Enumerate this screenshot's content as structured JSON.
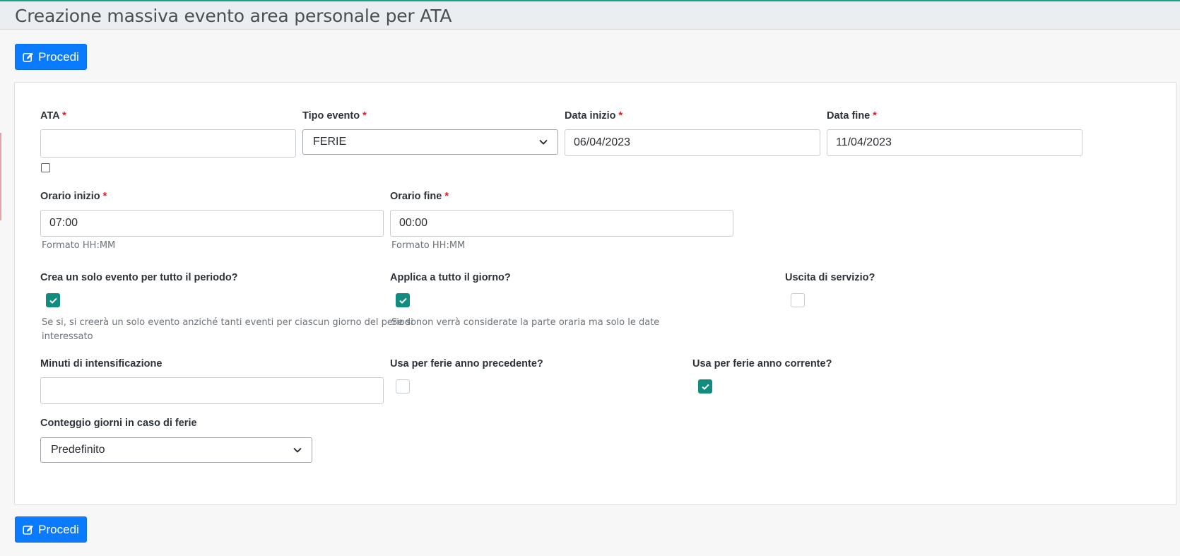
{
  "header": {
    "title": "Creazione massiva evento area personale per ATA"
  },
  "actions": {
    "proceed_label": "Procedi"
  },
  "form": {
    "required_mark": "*",
    "ata": {
      "label": "ATA",
      "value": "",
      "checkbox_checked": false
    },
    "tipo_evento": {
      "label": "Tipo evento",
      "selected": "FERIE"
    },
    "data_inizio": {
      "label": "Data inizio",
      "value": "06/04/2023"
    },
    "data_fine": {
      "label": "Data fine",
      "value": "11/04/2023"
    },
    "orario_inizio": {
      "label": "Orario inizio",
      "value": "07:00",
      "help": "Formato HH:MM"
    },
    "orario_fine": {
      "label": "Orario fine",
      "value": "00:00",
      "help": "Formato HH:MM"
    },
    "solo_evento": {
      "label": "Crea un solo evento per tutto il periodo?",
      "checked": true,
      "help_line1": "Se si, si creerà un solo evento anziché tanti eventi per ciascun giorno del periodo",
      "help_line2": "interessato"
    },
    "tutto_giorno": {
      "label": "Applica a tutto il giorno?",
      "checked": true,
      "help": "Se si non verrà considerate la parte oraria ma solo le date"
    },
    "uscita_servizio": {
      "label": "Uscita di servizio?",
      "checked": false
    },
    "minuti_intensificazione": {
      "label": "Minuti di intensificazione",
      "value": ""
    },
    "ferie_anno_precedente": {
      "label": "Usa per ferie anno precedente?",
      "checked": false
    },
    "ferie_anno_corrente": {
      "label": "Usa per ferie anno corrente?",
      "checked": true
    },
    "conteggio_giorni": {
      "label": "Conteggio giorni in caso di ferie",
      "selected": "Predefinito"
    }
  },
  "colors": {
    "primary": "#0a7bff",
    "checkbox_on": "#128c7e",
    "required": "#d0222c",
    "header_bg": "#ebeef0"
  }
}
